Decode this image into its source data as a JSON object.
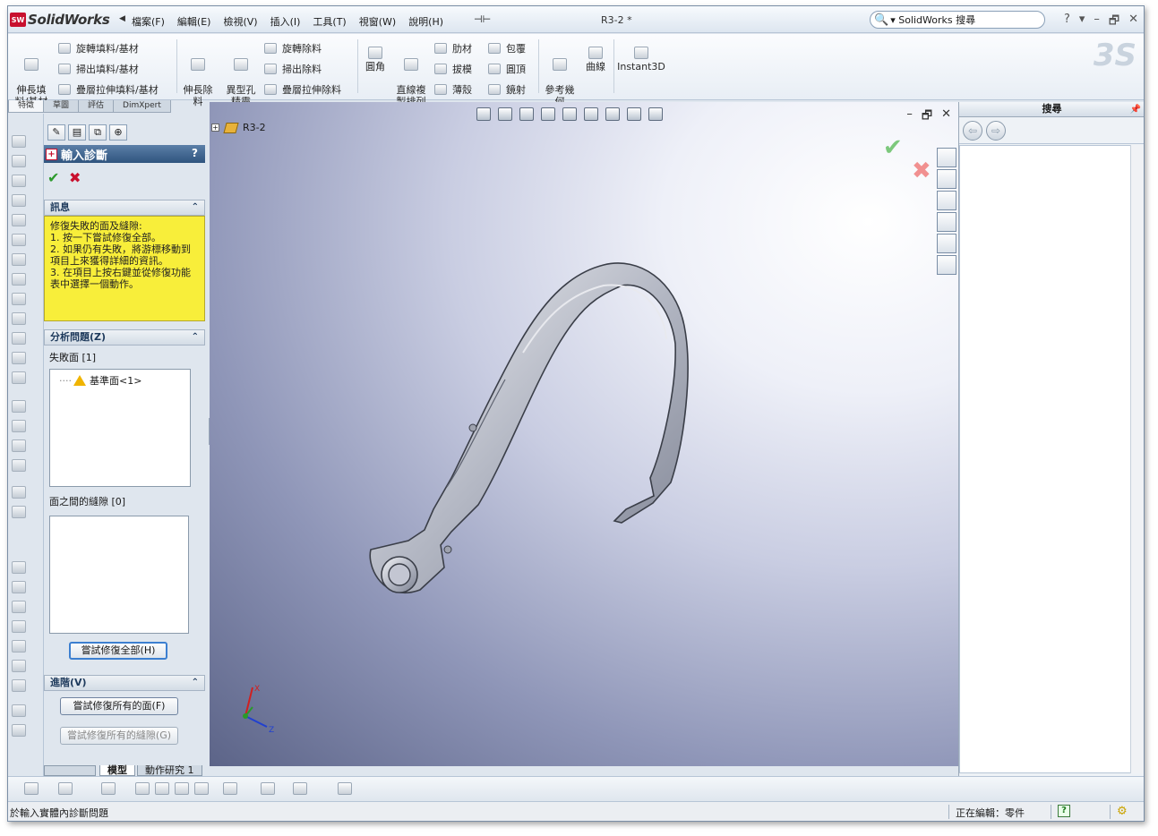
{
  "app": {
    "logo_badge": "SW",
    "logo_text": "SolidWorks",
    "menus": [
      "檔案(F)",
      "編輯(E)",
      "檢視(V)",
      "插入(I)",
      "工具(T)",
      "視窗(W)",
      "說明(H)"
    ],
    "document_title": "R3-2 *",
    "search_placeholder": "▾ SolidWorks 搜尋",
    "window_controls": [
      "?",
      "▾",
      "–",
      "🗗",
      "✕"
    ]
  },
  "command_manager": {
    "large_buttons": {
      "extrude_boss": "伸長填\n料/基材",
      "extrude_cut": "伸長除\n料",
      "hole_wizard": "異型孔\n精靈",
      "fillet": "圓角",
      "linear_pattern": "直線複\n製排列",
      "ref_geometry": "參考幾\n何",
      "curves": "曲線",
      "instant3d": "Instant3D"
    },
    "small_buttons": {
      "revolve_boss": "旋轉填料/基材",
      "sweep_boss": "掃出填料/基材",
      "loft_boss": "疊層拉伸填料/基材",
      "revolve_cut": "旋轉除料",
      "sweep_cut": "掃出除料",
      "loft_cut": "疊層拉伸除料",
      "rib": "肋材",
      "draft": "拔模",
      "shell": "薄殼",
      "wrap": "包覆",
      "dome": "圓頂",
      "mirror": "鏡射"
    },
    "tabs": [
      "特徵",
      "草圖",
      "評估",
      "DimXpert"
    ],
    "active_tab": "特徵"
  },
  "property_manager": {
    "title": "輸入診斷",
    "help": "?",
    "ok": "✔",
    "cancel": "✖",
    "message_group": {
      "label": "訊息",
      "text": "修復失敗的面及縫隙:\n  1. 按一下嘗試修復全部。\n  2. 如果仍有失敗，將游標移動到項目上來獲得詳細的資訊。\n  3. 在項目上按右鍵並從修復功能表中選擇一個動作。"
    },
    "analyze_group": {
      "label": "分析問題(Z)",
      "faulty_faces_label": "失敗面 [1]",
      "faulty_faces": [
        "基準面<1>"
      ],
      "gaps_label": "面之間的縫隙 [0]",
      "attempt_all_button": "嘗試修復全部(H)"
    },
    "advanced_group": {
      "label": "進階(V)",
      "heal_faces_button": "嘗試修復所有的面(F)",
      "heal_gaps_button": "嘗試修復所有的縫隙(G)"
    },
    "collapse_glyph": "⌃"
  },
  "viewport": {
    "tree_root": "R3-2",
    "plus": "+",
    "controls": [
      "–",
      "🗗",
      "✕"
    ],
    "confirm_ok": "✔",
    "confirm_cancel": "✖",
    "triad_labels": {
      "x": "X",
      "z": "Z"
    }
  },
  "task_pane": {
    "title": "搜尋",
    "back": "⇦",
    "forward": "⇨"
  },
  "model_tabs": [
    "模型",
    "動作研究 1"
  ],
  "active_model_tab": "模型",
  "status": {
    "message": "於輸入實體內診斷問題",
    "editing": "正在編輯：零件",
    "help_icon": "?",
    "rebuild_icon": "⚙"
  },
  "colors": {
    "accent_title": "#2f547e",
    "message_bg": "#f8ee3a",
    "ok_green": "#2c9a2c",
    "cancel_red": "#c8102e"
  }
}
